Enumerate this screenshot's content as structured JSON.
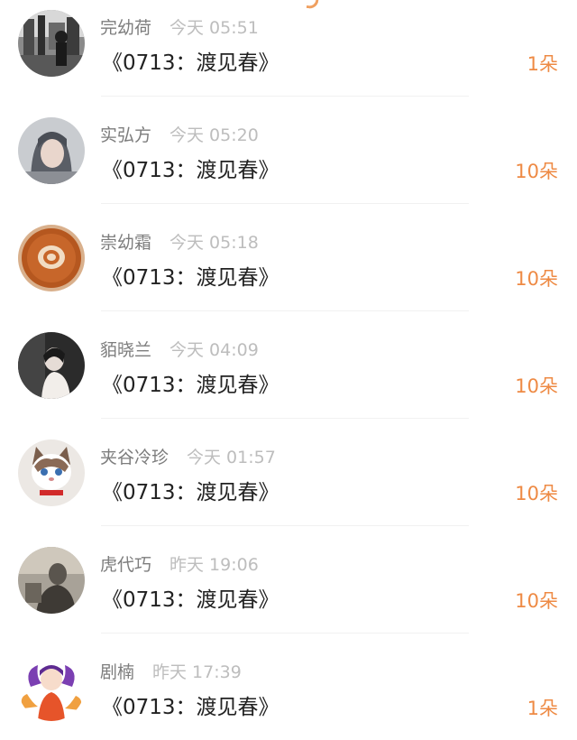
{
  "colors": {
    "accent": "#ee8a44",
    "username": "#7d7d7d",
    "time": "#bdbdbd",
    "title": "#222222",
    "divider": "#f1f1f1"
  },
  "list": {
    "items": [
      {
        "avatar_icon": "avatar-street-photo-icon",
        "username": "完幼荷",
        "time": "今天 05:51",
        "title": "《0713：渡见春》",
        "gift": "1朵"
      },
      {
        "avatar_icon": "avatar-girl-portrait-icon",
        "username": "实弘方",
        "time": "今天 05:20",
        "title": "《0713：渡见春》",
        "gift": "10朵"
      },
      {
        "avatar_icon": "avatar-latte-art-icon",
        "username": "崇幼霜",
        "time": "今天 05:18",
        "title": "《0713：渡见春》",
        "gift": "10朵"
      },
      {
        "avatar_icon": "avatar-woman-dark-icon",
        "username": "貊晓兰",
        "time": "今天 04:09",
        "title": "《0713：渡见春》",
        "gift": "10朵"
      },
      {
        "avatar_icon": "avatar-ragdoll-cat-icon",
        "username": "夹谷冷珍",
        "time": "今天 01:57",
        "title": "《0713：渡见春》",
        "gift": "10朵"
      },
      {
        "avatar_icon": "avatar-vintage-photo-icon",
        "username": "虎代巧",
        "time": "昨天 19:06",
        "title": "《0713：渡见春》",
        "gift": "10朵"
      },
      {
        "avatar_icon": "avatar-anime-fox-girl-icon",
        "username": "剧楠",
        "time": "昨天 17:39",
        "title": "《0713：渡见春》",
        "gift": "1朵"
      }
    ]
  }
}
